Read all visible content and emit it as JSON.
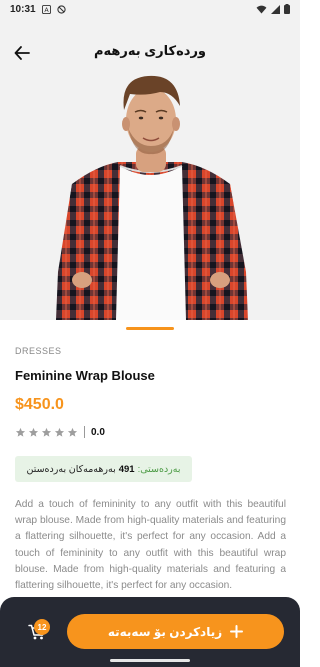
{
  "status_bar": {
    "time": "10:31",
    "icons": [
      "a-icon",
      "dnd-icon",
      "wifi-icon",
      "signal-icon",
      "battery-icon"
    ]
  },
  "app_bar": {
    "title": "وردەکاری بەرهەم",
    "back_icon": "arrow-left-icon"
  },
  "product": {
    "category": "DRESSES",
    "name": "Feminine Wrap Blouse",
    "price": "$450.0",
    "rating_value": "0.0",
    "stars_filled": 0,
    "stars_total": 5,
    "stock": {
      "label": "بەردەستی:",
      "count": "491",
      "suffix": "بەرهەمەکان بەردەستن"
    },
    "description": "Add a touch of femininity to any outfit with this beautiful wrap blouse. Made from high-quality materials and featuring a flattering silhouette, it's perfect for any occasion. Add a touch of femininity to any outfit with this beautiful wrap blouse. Made from high-quality materials and featuring a flattering silhouette, it's perfect for any occasion."
  },
  "image_indicator": {
    "active_index": 0
  },
  "bottom_bar": {
    "cart_count": "12",
    "add_to_cart_label": "زیادکردن بۆ سەبەتە"
  },
  "colors": {
    "accent": "#f7941d",
    "bottom_bar": "#262933",
    "background": "#f2f2f2",
    "stock_badge": "#e7f3e6"
  }
}
